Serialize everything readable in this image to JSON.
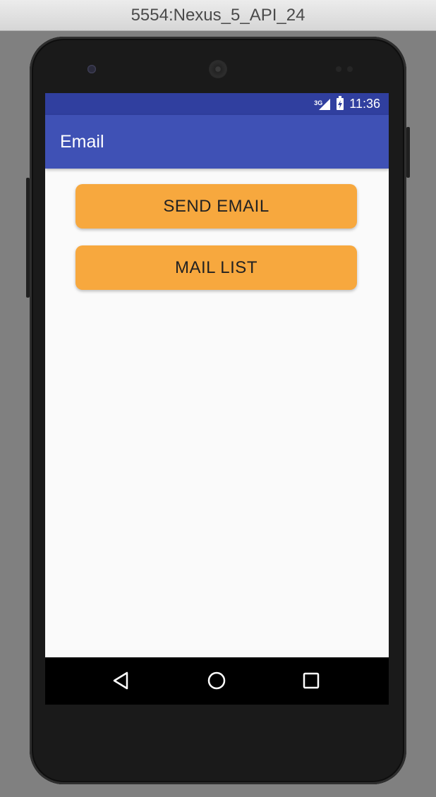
{
  "window": {
    "title": "5554:Nexus_5_API_24"
  },
  "status_bar": {
    "network": "3G",
    "time": "11:36"
  },
  "app_bar": {
    "title": "Email"
  },
  "buttons": {
    "send_email": "SEND EMAIL",
    "mail_list": "MAIL LIST"
  },
  "nav_bar": {
    "icons": [
      "back-icon",
      "home-icon",
      "recents-icon"
    ]
  },
  "colors": {
    "status_bar": "#303f9f",
    "app_bar": "#3f51b5",
    "button": "#f7a83e",
    "screen_bg": "#fafafa"
  }
}
